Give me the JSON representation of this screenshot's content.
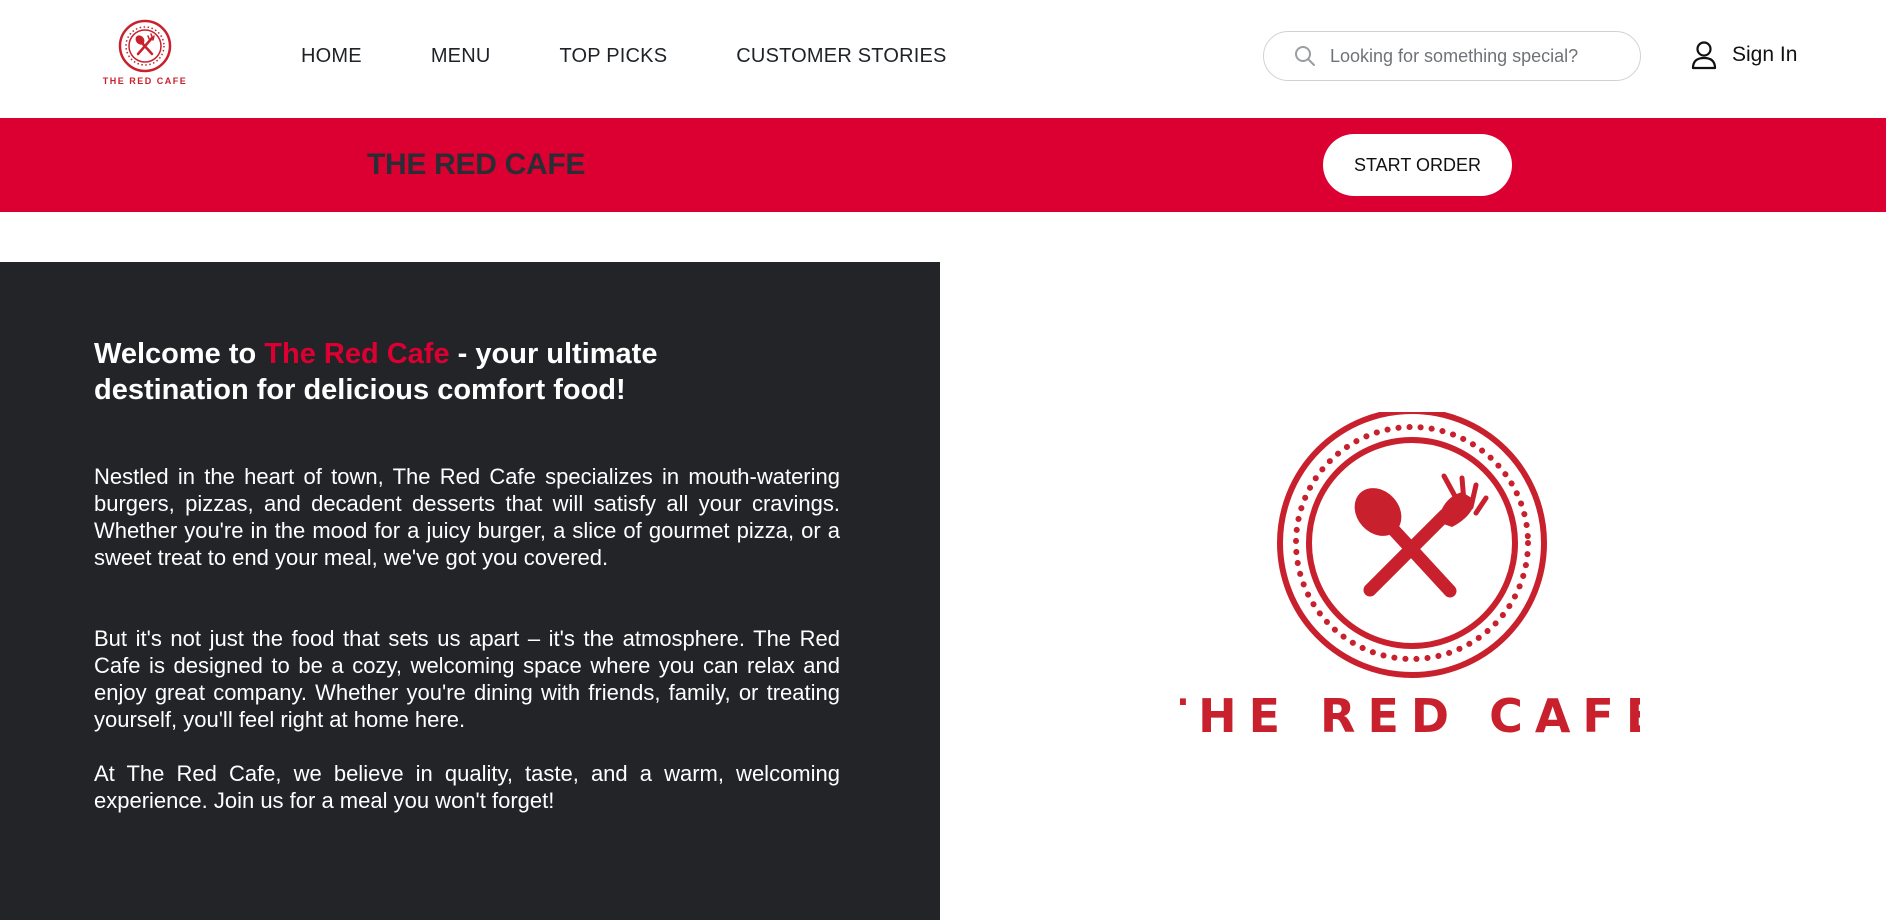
{
  "header": {
    "logo_text": "THE RED CAFE",
    "nav": [
      "HOME",
      "MENU",
      "TOP PICKS",
      "CUSTOMER STORIES"
    ],
    "search": {
      "placeholder": "Looking for something special?",
      "icon": "search-icon"
    },
    "signin": {
      "label": "Sign In",
      "icon": "user-icon"
    }
  },
  "banner": {
    "brand": "THE RED CAFE",
    "start_order": "START ORDER"
  },
  "hero": {
    "heading_prefix": "Welcome to ",
    "heading_accent": "The Red Cafe",
    "heading_suffix": " - your ultimate destination for delicious comfort food!",
    "paragraphs": [
      "Nestled in the heart of town, The Red Cafe specializes in mouth-watering burgers, pizzas, and decadent desserts that will satisfy all your cravings. Whether you're in the mood for a juicy burger, a slice of gourmet pizza, or a sweet treat to end your meal, we've got you covered.",
      "But it's not just the food that sets us apart – it's the atmosphere. The Red Cafe is designed to be a cozy, welcoming space where you can relax and enjoy great company. Whether you're dining with friends, family, or treating yourself, you'll feel right at home here.",
      "At The Red Cafe, we believe in quality, taste, and a warm, welcoming experience. Join us for a meal you won't forget!"
    ],
    "logo_text": "THE RED CAFE"
  },
  "colors": {
    "brand_red": "#dc0032",
    "logo_red": "#c8202c",
    "dark_panel": "#222428"
  }
}
